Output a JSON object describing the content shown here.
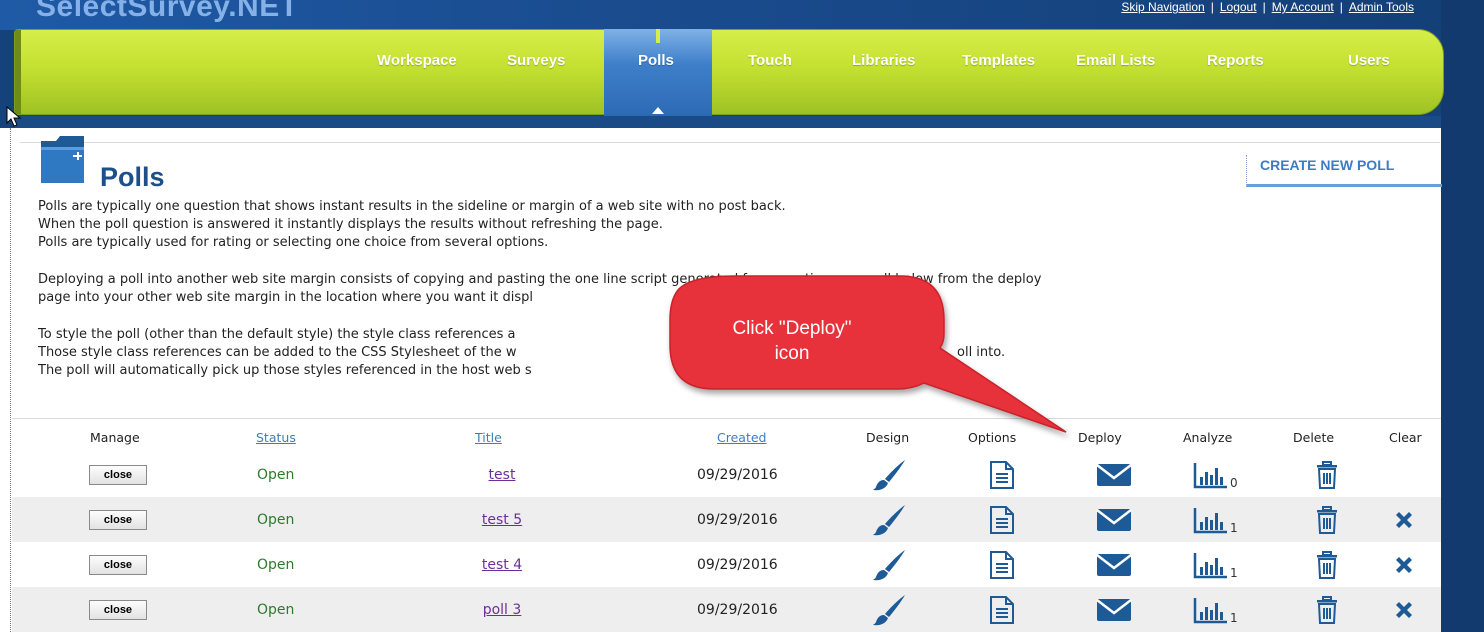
{
  "app": {
    "logo_text": "SelectSurvey.NET",
    "top_links": [
      "Skip Navigation",
      "Logout",
      "My Account",
      "Admin Tools"
    ]
  },
  "nav": {
    "items": [
      "Workspace",
      "Surveys",
      "Polls",
      "Touch",
      "Libraries",
      "Templates",
      "Email Lists",
      "Reports",
      "Users"
    ],
    "active": "Polls"
  },
  "page": {
    "title": "Polls",
    "create_button": "CREATE NEW POLL",
    "description": [
      "Polls are typically one question that shows instant results in the sideline or margin of a web site with no post back.",
      "When the poll question is answered it instantly displays the results without refreshing the page.",
      "Polls are typically used for rating or selecting one choice from several options.",
      "",
      "Deploying a poll into another web site margin consists of copying and pasting the one line script generated from creating your poll below from the deploy",
      "page into your other web site margin in the location where you want it displ",
      "",
      "To style the poll (other than the default style) the style class references a",
      "Those style class references can be added to the CSS Stylesheet of the w",
      "The poll will automatically pick up those styles referenced in the host web s"
    ],
    "description_tail": {
      "line9": "oll into."
    }
  },
  "callout": {
    "text_line1": "Click \"Deploy\"",
    "text_line2": "icon",
    "color": "#e8323a"
  },
  "table": {
    "headers": [
      "Manage",
      "Status",
      "Title",
      "Created",
      "Design",
      "Options",
      "Deploy",
      "Analyze",
      "Delete",
      "Clear"
    ],
    "rows": [
      {
        "manage": "close",
        "status": "Open",
        "title": "test",
        "created": "09/29/2016",
        "analyze_count": "0",
        "has_clear": false
      },
      {
        "manage": "close",
        "status": "Open",
        "title": "test 5",
        "created": "09/29/2016",
        "analyze_count": "1",
        "has_clear": true
      },
      {
        "manage": "close",
        "status": "Open",
        "title": "test 4",
        "created": "09/29/2016",
        "analyze_count": "1",
        "has_clear": true
      },
      {
        "manage": "close",
        "status": "Open",
        "title": "poll 3",
        "created": "09/29/2016",
        "analyze_count": "1",
        "has_clear": true
      }
    ]
  },
  "colors": {
    "nav_green": "#c4e031",
    "header_blue": "#16427c",
    "icon_blue": "#1d5a96",
    "link_blue": "#3d7cc4",
    "status_green": "#2d7a2d"
  },
  "icons": {
    "design": "paintbrush-icon",
    "options": "document-icon",
    "deploy": "envelope-icon",
    "analyze": "bar-chart-icon",
    "delete": "trash-icon",
    "clear": "x-icon"
  }
}
